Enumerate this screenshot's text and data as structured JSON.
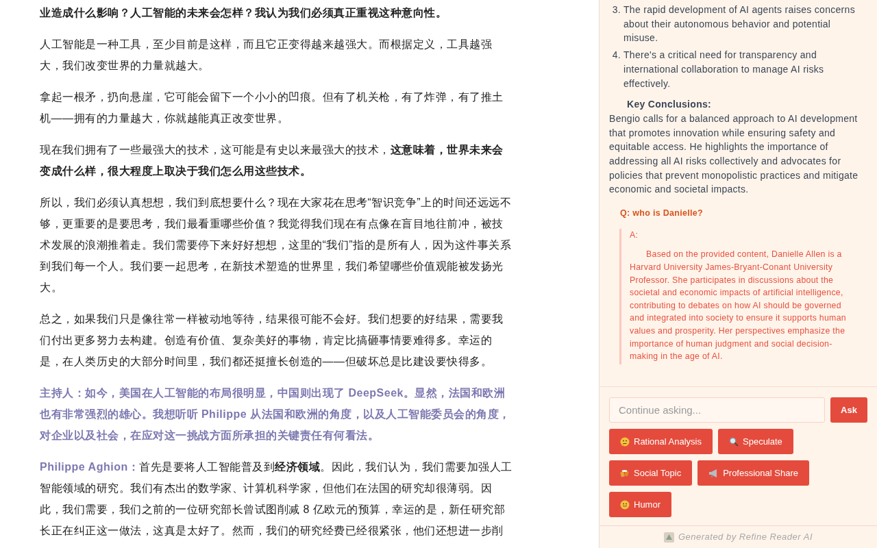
{
  "article": {
    "paragraphs": [
      {
        "kind": "text",
        "text": "**业造成什么影响？人工智能的未来会怎样？我认为我们必须真正重视这种意向性。**"
      },
      {
        "kind": "text",
        "text": "人工智能是一种工具，至少目前是这样，而且它正变得越来越强大。而根据定义，工具越强大，我们改变世界的力量就越大。"
      },
      {
        "kind": "text",
        "text": "拿起一根矛，扔向悬崖，它可能会留下一个小小的凹痕。但有了机关枪，有了炸弹，有了推土机——拥有的力量越大，你就越能真正改变世界。"
      },
      {
        "kind": "text",
        "text": "现在我们拥有了一些最强大的技术，这可能是有史以来最强大的技术，**这意味着，世界未来会变成什么样，很大程度上取决于我们怎么用这些技术。**"
      },
      {
        "kind": "text",
        "text": "所以，我们必须认真想想，我们到底想要什么？现在大家花在思考“智识竞争”上的时间还远远不够，更重要的是要思考，我们最看重哪些价值？我觉得我们现在有点像在盲目地往前冲，被技术发展的浪潮推着走。我们需要停下来好好想想，这里的“我们”指的是所有人，因为这件事关系到我们每一个人。我们要一起思考，在新技术塑造的世界里，我们希望哪些价值观能被发扬光大。"
      },
      {
        "kind": "text",
        "text": "总之，如果我们只是像往常一样被动地等待，结果很可能不会好。我们想要的好结果，需要我们付出更多努力去构建。创造有价值、复杂美好的事物，肯定比搞砸事情要难得多。幸运的是，在人类历史的大部分时间里，我们都还挺擅长创造的——但破坏总是比建设要快得多。"
      },
      {
        "kind": "host",
        "text": "主持人：如今，美国在人工智能的布局很明显，中国则出现了 DeepSeek。显然，法国和欧洲也有非常强烈的雄心。我想听听 Philippe 从法国和欧洲的角度，以及人工智能委员会的角度，对企业以及社会，在应对这一挑战方面所承担的关键责任有何看法。"
      },
      {
        "kind": "speaker",
        "speaker": "Philippe Aghion：",
        "text": "首先是要将人工智能普及到**经济领域**。因此，我们认为，我们需要加强人工智能领域的研究。我们有杰出的数学家、计算机科学家，但他们在法国的研究却很薄弱。因此，我们需要，我们之前的一位研究部长曾试图削减 8 亿欧元的预算，幸运的是，新任研究部长正在纠正这一做法，这真是太好了。然而，我们的研究经费已经很紧张，他们还想进一步削"
      }
    ]
  },
  "panel": {
    "list": [
      {
        "number": "3.",
        "text": "The rapid development of AI agents raises concerns about their autonomous behavior and potential misuse."
      },
      {
        "number": "4.",
        "text": "There's a critical need for transparency and international collaboration to manage AI risks effectively."
      }
    ],
    "heading": "Key Conclusions:",
    "conclusion": "Bengio calls for a balanced approach to AI development that promotes innovation while ensuring safety and equitable access. He highlights the importance of addressing all AI risks collectively and advocates for policies that prevent monopolistic practices and mitigate economic and societal impacts.",
    "question": "Q: who is Danielle?",
    "answer_label": "A:",
    "answer": "Based on the provided content, Danielle Allen is a Harvard University James-Bryant-Conant University Professor. She participates in discussions about the societal and economic impacts of artificial intelligence, contributing to debates on how AI should be governed and integrated into society to ensure it supports human values and prosperity. Her perspectives emphasize the importance of human judgment and social decision-making in the age of AI.",
    "input": {
      "placeholder": "Continue asking..."
    },
    "ask_button": "Ask",
    "quick_buttons": [
      {
        "kind": "think",
        "label": "Rational Analysis"
      },
      {
        "kind": "search",
        "label": "Speculate"
      },
      {
        "kind": "cheers",
        "label": "Social Topic"
      },
      {
        "kind": "megaphone",
        "label": "Professional Share"
      },
      {
        "kind": "smile",
        "label": "Humor"
      }
    ],
    "footer": "Generated by Refine Reader AI"
  }
}
